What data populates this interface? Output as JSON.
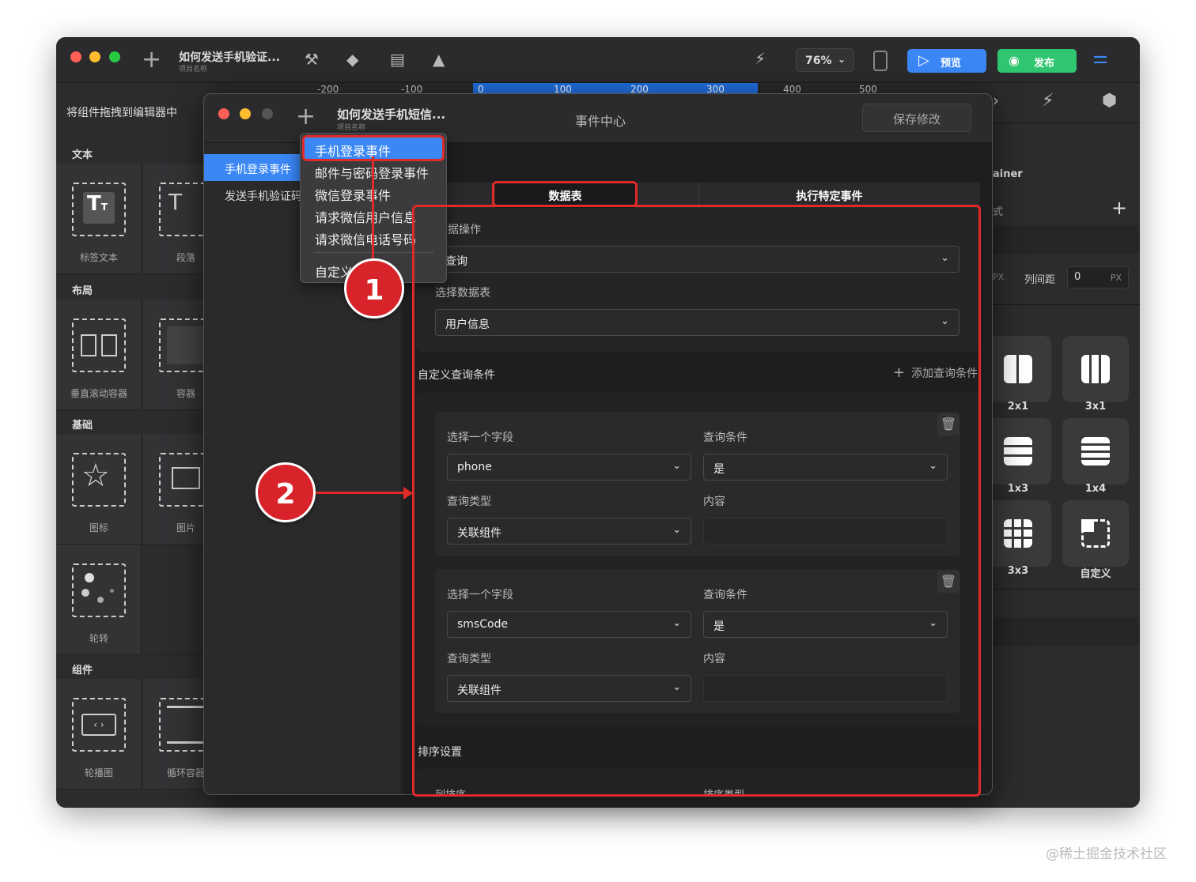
{
  "toolbar": {
    "project_title": "如何发送手机验证...",
    "project_sub": "项目名称",
    "zoom": "76%",
    "preview_label": "预览",
    "publish_label": "发布"
  },
  "ruler": {
    "ticks": [
      "-200",
      "-100",
      "0",
      "100",
      "200",
      "300",
      "400",
      "500"
    ]
  },
  "left_panel": {
    "hint": "将组件拖拽到编辑器中",
    "sections": [
      "文本",
      "布局",
      "基础",
      "组件"
    ],
    "components": [
      "标签文本",
      "段落",
      "垂直滚动容器",
      "容器",
      "图标",
      "图片",
      "轮转",
      "轮播图",
      "循环容器"
    ]
  },
  "right_panel": {
    "partial_label": "ainer",
    "partial_label2": "式",
    "px_unit": "PX",
    "col_gap_label": "列间距",
    "col_gap_value": "0",
    "px_unit2": "PX",
    "layouts": [
      "2x1",
      "3x1",
      "1x3",
      "1x4",
      "3x3",
      "自定义"
    ]
  },
  "dialog": {
    "title": "如何发送手机短信...",
    "subtitle": "项目名称",
    "center_title": "事件中心",
    "save_label": "保存修改",
    "events": [
      "手机登录事件",
      "发送手机验证码"
    ],
    "tabs": [
      "数据表",
      "执行特定事件"
    ],
    "data_op_label": "据操作",
    "data_op_value": "查询",
    "table_label": "选择数据表",
    "table_value": "用户信息",
    "custom_cond_label": "自定义查询条件",
    "add_cond_label": "添加查询条件",
    "conditions": [
      {
        "field_label": "选择一个字段",
        "field_value": "phone",
        "cond_label": "查询条件",
        "cond_value": "是",
        "type_label": "查询类型",
        "type_value": "关联组件",
        "content_label": "内容"
      },
      {
        "field_label": "选择一个字段",
        "field_value": "smsCode",
        "cond_label": "查询条件",
        "cond_value": "是",
        "type_label": "查询类型",
        "type_value": "关联组件",
        "content_label": "内容"
      }
    ],
    "sort_label": "排序设置",
    "sort_col_label": "列排序",
    "sort_type_label": "排序类型"
  },
  "dropdown_menu": {
    "items": [
      "手机登录事件",
      "邮件与密码登录事件",
      "微信登录事件",
      "请求微信用户信息",
      "请求微信电话号码",
      "自定义"
    ]
  },
  "annotations": {
    "badge1": "1",
    "badge2": "2"
  },
  "watermark": "@稀土掘金技术社区",
  "colors": {
    "accent": "#3a87f5",
    "publish": "#2ec66f",
    "annotation": "#e02a2a"
  }
}
